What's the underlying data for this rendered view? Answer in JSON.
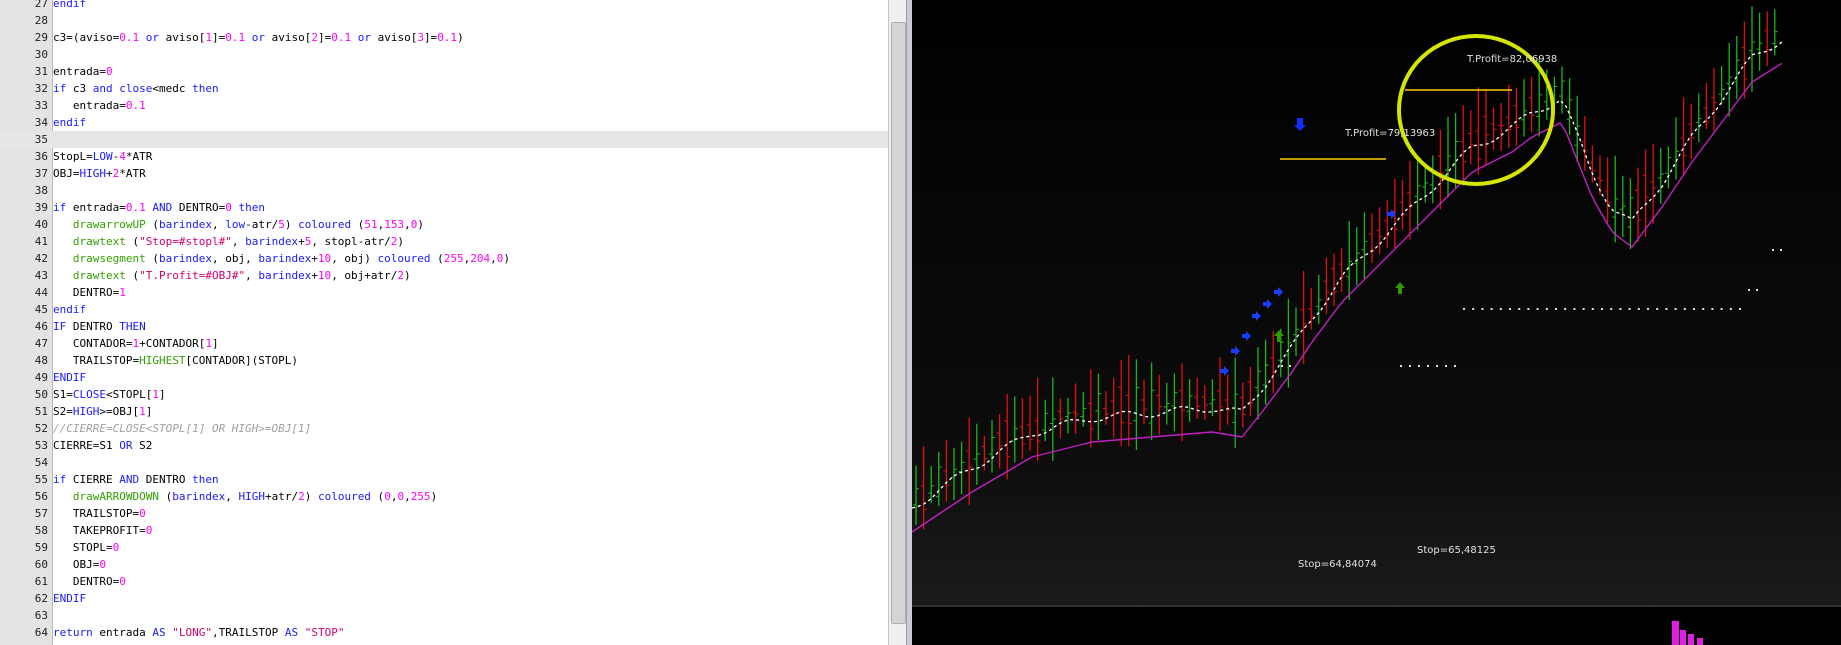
{
  "editor": {
    "highlight_line": 35,
    "lines": [
      {
        "n": "27",
        "t": [
          [
            "endif",
            "kw"
          ]
        ]
      },
      {
        "n": "28",
        "t": []
      },
      {
        "n": "29",
        "t": [
          [
            "c3=(aviso=",
            "ident"
          ],
          [
            "0.1",
            "num"
          ],
          [
            " ",
            "ident"
          ],
          [
            "or",
            "kw"
          ],
          [
            " aviso[",
            "ident"
          ],
          [
            "1",
            "num"
          ],
          [
            "]=",
            "ident"
          ],
          [
            "0.1",
            "num"
          ],
          [
            " ",
            "ident"
          ],
          [
            "or",
            "kw"
          ],
          [
            " aviso[",
            "ident"
          ],
          [
            "2",
            "num"
          ],
          [
            "]=",
            "ident"
          ],
          [
            "0.1",
            "num"
          ],
          [
            " ",
            "ident"
          ],
          [
            "or",
            "kw"
          ],
          [
            " aviso[",
            "ident"
          ],
          [
            "3",
            "num"
          ],
          [
            "]=",
            "ident"
          ],
          [
            "0.1",
            "num"
          ],
          [
            ")",
            "ident"
          ]
        ]
      },
      {
        "n": "30",
        "t": []
      },
      {
        "n": "31",
        "t": [
          [
            "entrada=",
            "ident"
          ],
          [
            "0",
            "num"
          ]
        ]
      },
      {
        "n": "32",
        "t": [
          [
            "if",
            "kw"
          ],
          [
            " c3 ",
            "ident"
          ],
          [
            "and",
            "kw"
          ],
          [
            " ",
            "ident"
          ],
          [
            "close",
            "kw"
          ],
          [
            "<medc ",
            "ident"
          ],
          [
            "then",
            "kw"
          ]
        ]
      },
      {
        "n": "33",
        "t": [
          [
            "   entrada=",
            "ident"
          ],
          [
            "0.1",
            "num"
          ]
        ]
      },
      {
        "n": "34",
        "t": [
          [
            "endif",
            "kw"
          ]
        ]
      },
      {
        "n": "35",
        "t": []
      },
      {
        "n": "36",
        "t": [
          [
            "StopL=",
            "ident"
          ],
          [
            "LOW",
            "kw"
          ],
          [
            "-",
            "ident"
          ],
          [
            "4",
            "num"
          ],
          [
            "*ATR",
            "ident"
          ]
        ]
      },
      {
        "n": "37",
        "t": [
          [
            "OBJ=",
            "ident"
          ],
          [
            "HIGH",
            "kw"
          ],
          [
            "+",
            "ident"
          ],
          [
            "2",
            "num"
          ],
          [
            "*ATR",
            "ident"
          ]
        ]
      },
      {
        "n": "38",
        "t": []
      },
      {
        "n": "39",
        "t": [
          [
            "if",
            "kw"
          ],
          [
            " entrada=",
            "ident"
          ],
          [
            "0.1",
            "num"
          ],
          [
            " ",
            "ident"
          ],
          [
            "AND",
            "kw"
          ],
          [
            " DENTRO=",
            "ident"
          ],
          [
            "0",
            "num"
          ],
          [
            " ",
            "ident"
          ],
          [
            "then",
            "kw"
          ]
        ]
      },
      {
        "n": "40",
        "t": [
          [
            "   ",
            "ident"
          ],
          [
            "drawarrowUP",
            "fn"
          ],
          [
            " (",
            "ident"
          ],
          [
            "barindex",
            "kw"
          ],
          [
            ", ",
            "ident"
          ],
          [
            "low",
            "kw"
          ],
          [
            "-atr/",
            "ident"
          ],
          [
            "5",
            "num"
          ],
          [
            ") ",
            "ident"
          ],
          [
            "coloured",
            "kw"
          ],
          [
            " (",
            "ident"
          ],
          [
            "51",
            "num"
          ],
          [
            ",",
            "ident"
          ],
          [
            "153",
            "num"
          ],
          [
            ",",
            "ident"
          ],
          [
            "0",
            "num"
          ],
          [
            ")",
            "ident"
          ]
        ]
      },
      {
        "n": "41",
        "t": [
          [
            "   ",
            "ident"
          ],
          [
            "drawtext",
            "fn"
          ],
          [
            " (",
            "ident"
          ],
          [
            "\"Stop=#stopl#\"",
            "str"
          ],
          [
            ", ",
            "ident"
          ],
          [
            "barindex",
            "kw"
          ],
          [
            "+",
            "ident"
          ],
          [
            "5",
            "num"
          ],
          [
            ", stopl-atr/",
            "ident"
          ],
          [
            "2",
            "num"
          ],
          [
            ")",
            "ident"
          ]
        ]
      },
      {
        "n": "42",
        "t": [
          [
            "   ",
            "ident"
          ],
          [
            "drawsegment",
            "fn"
          ],
          [
            " (",
            "ident"
          ],
          [
            "barindex",
            "kw"
          ],
          [
            ", obj, ",
            "ident"
          ],
          [
            "barindex",
            "kw"
          ],
          [
            "+",
            "ident"
          ],
          [
            "10",
            "num"
          ],
          [
            ", obj) ",
            "ident"
          ],
          [
            "coloured",
            "kw"
          ],
          [
            " (",
            "ident"
          ],
          [
            "255",
            "num"
          ],
          [
            ",",
            "ident"
          ],
          [
            "204",
            "num"
          ],
          [
            ",",
            "ident"
          ],
          [
            "0",
            "num"
          ],
          [
            ")",
            "ident"
          ]
        ]
      },
      {
        "n": "43",
        "t": [
          [
            "   ",
            "ident"
          ],
          [
            "drawtext",
            "fn"
          ],
          [
            " (",
            "ident"
          ],
          [
            "\"T.Profit=#OBJ#\"",
            "str"
          ],
          [
            ", ",
            "ident"
          ],
          [
            "barindex",
            "kw"
          ],
          [
            "+",
            "ident"
          ],
          [
            "10",
            "num"
          ],
          [
            ", obj+atr/",
            "ident"
          ],
          [
            "2",
            "num"
          ],
          [
            ")",
            "ident"
          ]
        ]
      },
      {
        "n": "44",
        "t": [
          [
            "   DENTRO=",
            "ident"
          ],
          [
            "1",
            "num"
          ]
        ]
      },
      {
        "n": "45",
        "t": [
          [
            "endif",
            "kw"
          ]
        ]
      },
      {
        "n": "46",
        "t": [
          [
            "IF",
            "kw"
          ],
          [
            " DENTRO ",
            "ident"
          ],
          [
            "THEN",
            "kw"
          ]
        ]
      },
      {
        "n": "47",
        "t": [
          [
            "   CONTADOR=",
            "ident"
          ],
          [
            "1",
            "num"
          ],
          [
            "+CONTADOR[",
            "ident"
          ],
          [
            "1",
            "num"
          ],
          [
            "]",
            "ident"
          ]
        ]
      },
      {
        "n": "48",
        "t": [
          [
            "   TRAILSTOP=",
            "ident"
          ],
          [
            "HIGHEST",
            "fn"
          ],
          [
            "[CONTADOR](STOPL)",
            "ident"
          ]
        ]
      },
      {
        "n": "49",
        "t": [
          [
            "ENDIF",
            "kw"
          ]
        ]
      },
      {
        "n": "50",
        "t": [
          [
            "S1=",
            "ident"
          ],
          [
            "CLOSE",
            "kw"
          ],
          [
            "<STOPL[",
            "ident"
          ],
          [
            "1",
            "num"
          ],
          [
            "]",
            "ident"
          ]
        ]
      },
      {
        "n": "51",
        "t": [
          [
            "S2=",
            "ident"
          ],
          [
            "HIGH",
            "kw"
          ],
          [
            ">=OBJ[",
            "ident"
          ],
          [
            "1",
            "num"
          ],
          [
            "]",
            "ident"
          ]
        ]
      },
      {
        "n": "52",
        "t": [
          [
            "//CIERRE=CLOSE<STOPL[1] OR HIGH>=OBJ[1]",
            "cm"
          ]
        ]
      },
      {
        "n": "53",
        "t": [
          [
            "CIERRE=S1 ",
            "ident"
          ],
          [
            "OR",
            "kw"
          ],
          [
            " S2",
            "ident"
          ]
        ]
      },
      {
        "n": "54",
        "t": []
      },
      {
        "n": "55",
        "t": [
          [
            "if",
            "kw"
          ],
          [
            " CIERRE ",
            "ident"
          ],
          [
            "AND",
            "kw"
          ],
          [
            " DENTRO ",
            "ident"
          ],
          [
            "then",
            "kw"
          ]
        ]
      },
      {
        "n": "56",
        "t": [
          [
            "   ",
            "ident"
          ],
          [
            "drawARROWDOWN",
            "fn"
          ],
          [
            " (",
            "ident"
          ],
          [
            "barindex",
            "kw"
          ],
          [
            ", ",
            "ident"
          ],
          [
            "HIGH",
            "kw"
          ],
          [
            "+atr/",
            "ident"
          ],
          [
            "2",
            "num"
          ],
          [
            ") ",
            "ident"
          ],
          [
            "coloured",
            "kw"
          ],
          [
            " (",
            "ident"
          ],
          [
            "0",
            "num"
          ],
          [
            ",",
            "ident"
          ],
          [
            "0",
            "num"
          ],
          [
            ",",
            "ident"
          ],
          [
            "255",
            "num"
          ],
          [
            ")",
            "ident"
          ]
        ]
      },
      {
        "n": "57",
        "t": [
          [
            "   TRAILSTOP=",
            "ident"
          ],
          [
            "0",
            "num"
          ]
        ]
      },
      {
        "n": "58",
        "t": [
          [
            "   TAKEPROFIT=",
            "ident"
          ],
          [
            "0",
            "num"
          ]
        ]
      },
      {
        "n": "59",
        "t": [
          [
            "   STOPL=",
            "ident"
          ],
          [
            "0",
            "num"
          ]
        ]
      },
      {
        "n": "60",
        "t": [
          [
            "   OBJ=",
            "ident"
          ],
          [
            "0",
            "num"
          ]
        ]
      },
      {
        "n": "61",
        "t": [
          [
            "   DENTRO=",
            "ident"
          ],
          [
            "0",
            "num"
          ]
        ]
      },
      {
        "n": "62",
        "t": [
          [
            "ENDIF",
            "kw"
          ]
        ]
      },
      {
        "n": "63",
        "t": []
      },
      {
        "n": "64",
        "t": [
          [
            "return",
            "kw"
          ],
          [
            " entrada ",
            "ident"
          ],
          [
            "AS",
            "kw"
          ],
          [
            " ",
            "ident"
          ],
          [
            "\"LONG\"",
            "str"
          ],
          [
            ",TRAILSTOP ",
            "ident"
          ],
          [
            "AS",
            "kw"
          ],
          [
            " ",
            "ident"
          ],
          [
            "\"STOP\"",
            "str"
          ]
        ]
      }
    ]
  },
  "chart": {
    "annotations": {
      "tp1": "T.Profit=79,13963",
      "tp2": "T.Profit=82,06938",
      "stop1": "Stop=64,84074",
      "stop2": "Stop=65,48125"
    },
    "colors": {
      "background": "#000000",
      "up_bar": "#1fb41f",
      "down_bar": "#e01010",
      "trail_line": "#ffffff",
      "ma_line": "#c020c0",
      "entry_arrow": "#339900",
      "exit_arrow": "#1030ff",
      "exit_marker": "#1a3cff",
      "target_segment": "#ffcc00",
      "highlight_circle": "#d4e600",
      "volume_bar": "#e020e0"
    }
  }
}
